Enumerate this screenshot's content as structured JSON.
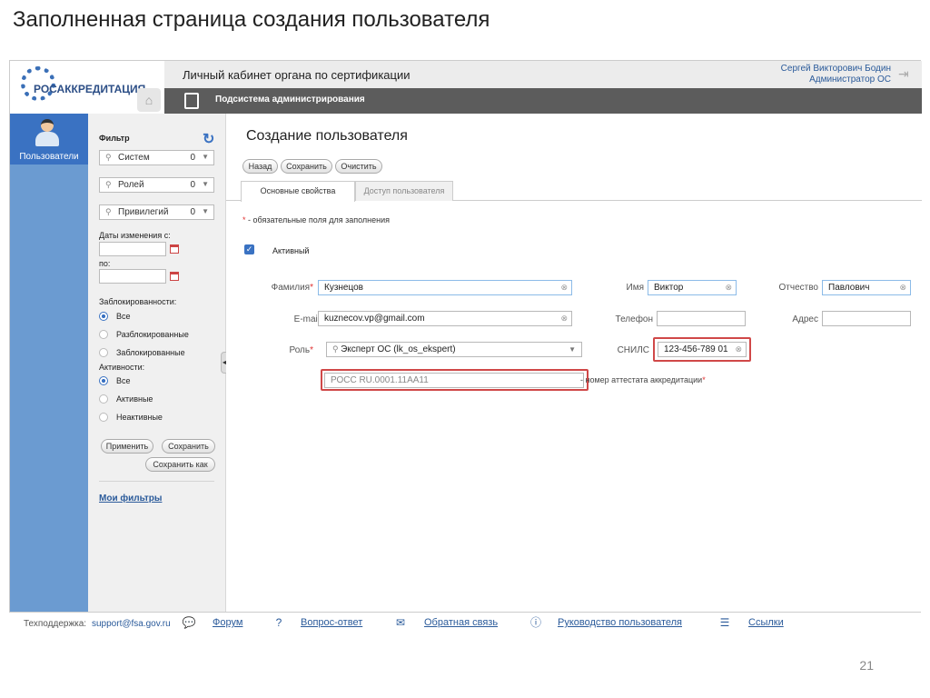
{
  "slide": {
    "title": "Заполненная страница создания пользователя",
    "page_number": "21"
  },
  "header": {
    "logo_text": "РОСАККРЕДИТАЦИЯ",
    "cabinet_title": "Личный кабинет органа по сертификации",
    "user_name": "Сергей Викторович Бодин",
    "user_role": "Администратор ОС",
    "subsystem_label": "Подсистема администрирования"
  },
  "nav": {
    "users_label": "Пользователи"
  },
  "filter": {
    "title": "Фильтр",
    "systems": {
      "label": "Систем",
      "count": "0"
    },
    "roles": {
      "label": "Ролей",
      "count": "0"
    },
    "privileges": {
      "label": "Привилегий",
      "count": "0"
    },
    "dates_from_label": "Даты изменения с:",
    "dates_to_label": "по:",
    "blocked_label": "Заблокированности:",
    "blocked_options": [
      "Все",
      "Разблокированные",
      "Заблокированные"
    ],
    "activity_label": "Активности:",
    "activity_options": [
      "Все",
      "Активные",
      "Неактивные"
    ],
    "apply_button": "Применить",
    "save_button": "Сохранить",
    "save_as_button": "Сохранить как",
    "my_filters": "Мои фильтры"
  },
  "main": {
    "page_title": "Создание пользователя",
    "toolbar": {
      "back": "Назад",
      "save": "Сохранить",
      "clear": "Очистить"
    },
    "tabs": [
      "Основные свойства",
      "Доступ пользователя"
    ],
    "required_note_star": "*",
    "required_note": " - обязательные поля для заполнения",
    "active_label": "Активный",
    "fields": {
      "lastname_label": "Фамилия",
      "lastname_value": "Кузнецов",
      "firstname_label": "Имя",
      "firstname_value": "Виктор",
      "middlename_label": "Отчество",
      "middlename_value": "Павлович",
      "email_label": "E-mail",
      "email_value": "kuznecov.vp@gmail.com",
      "phone_label": "Телефон",
      "phone_value": "",
      "address_label": "Адрес",
      "address_value": "",
      "role_label": "Роль",
      "role_value": "Эксперт ОС (lk_os_ekspert)",
      "snils_label": "СНИЛС",
      "snils_value": "123-456-789 01",
      "attest_value": "РОСС RU.0001.11АА11",
      "attest_note": "- номер аттестата аккредитации",
      "required_star": "*"
    }
  },
  "footer": {
    "support_label": "Техподдержка:",
    "support_email": "support@fsa.gov.ru",
    "links": [
      "Форум",
      "Вопрос-ответ",
      "Обратная связь",
      "Руководство пользователя",
      "Ссылки"
    ]
  }
}
